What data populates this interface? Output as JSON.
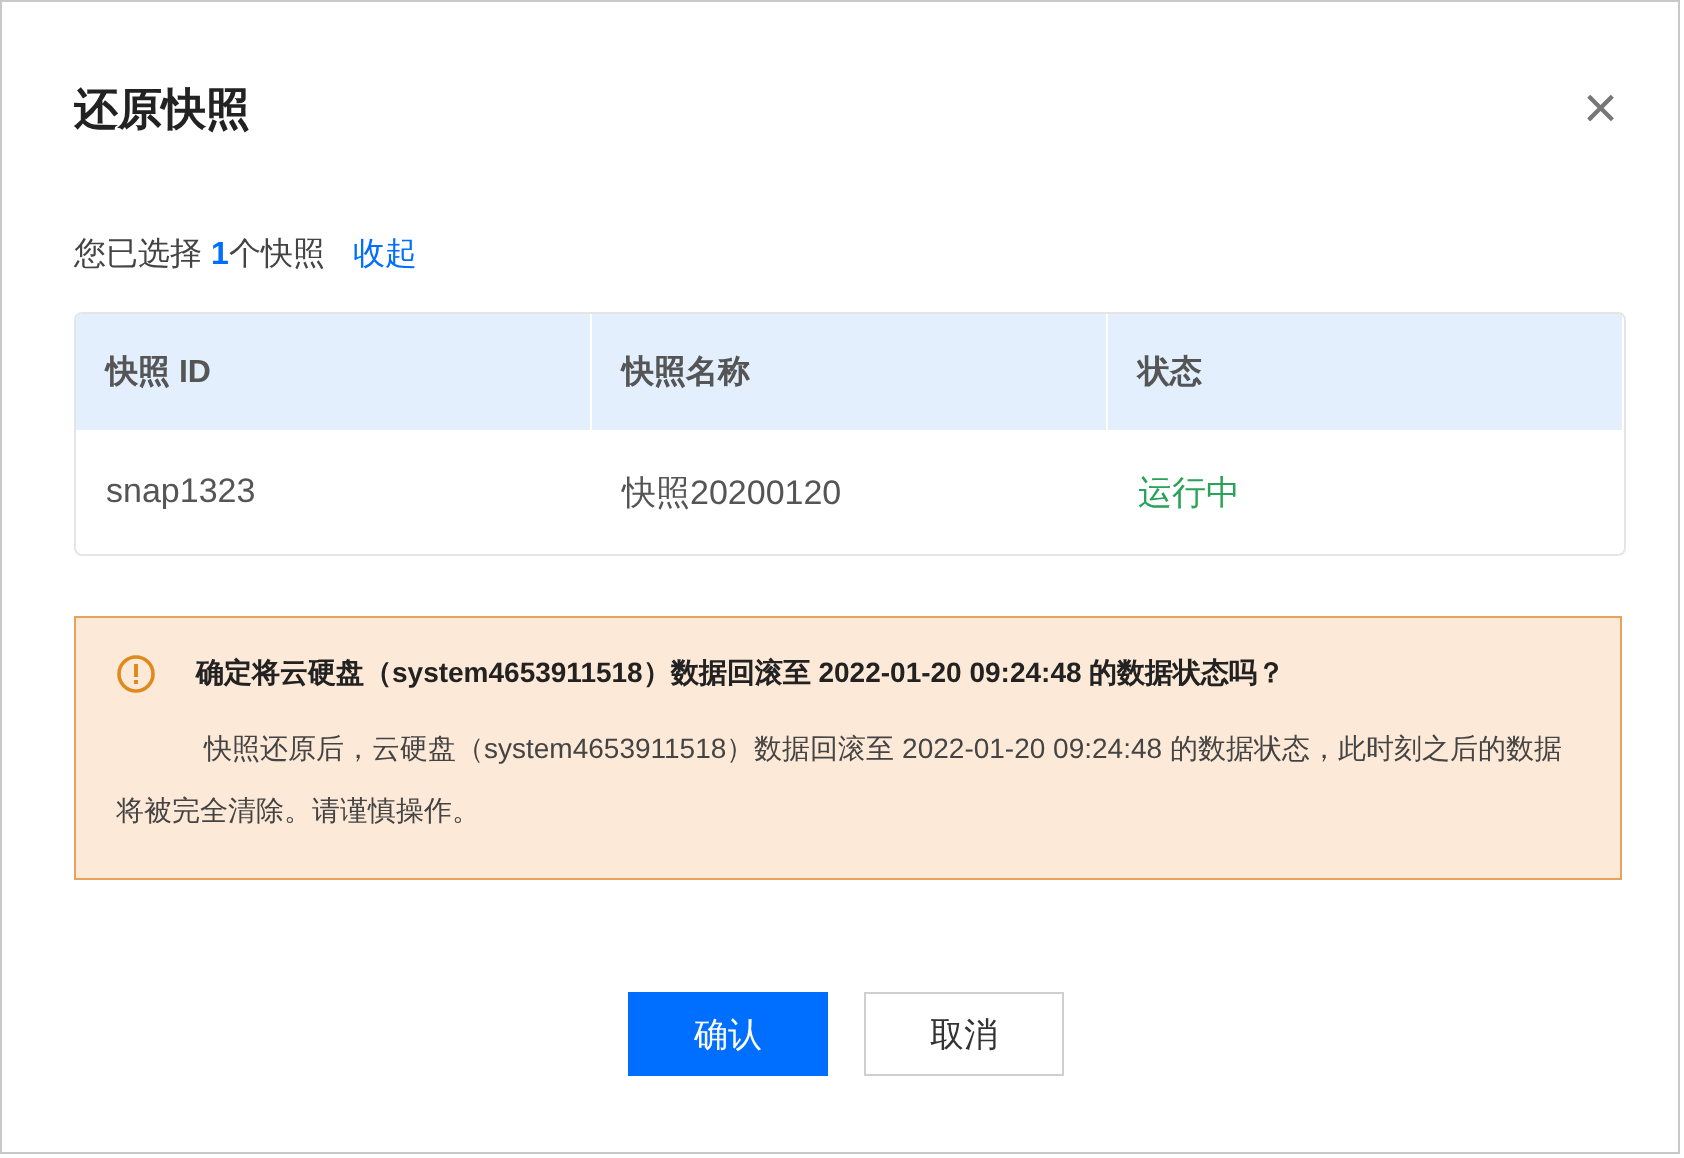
{
  "dialog": {
    "title": "还原快照",
    "close": "×"
  },
  "selection": {
    "text": "您已选择 **1**个快照",
    "toggle_link": "收起"
  },
  "table": {
    "columns": [
      "快照 ID",
      "快照名称",
      "状态"
    ],
    "rows": [
      {
        "id": "snap1323",
        "name": "快照20200120",
        "status": "运行中",
        "color": "#29a35a"
      }
    ]
  },
  "warning": {
    "title": "确定将云硬盘（system4653911518）数据回滚至 2022-01-20 09:24:48 的数据状态吗？",
    "body": "快照还原后，云硬盘（system4653911518）数据回滚至 2022-01-20 09:24:48 的数据状态，此时刻之后的数据将被完全清除。请谨慎操作。"
  },
  "buttons": [
    {
      "label": "确认",
      "kind": "primary"
    },
    {
      "label": "取消",
      "kind": "secondary"
    }
  ]
}
